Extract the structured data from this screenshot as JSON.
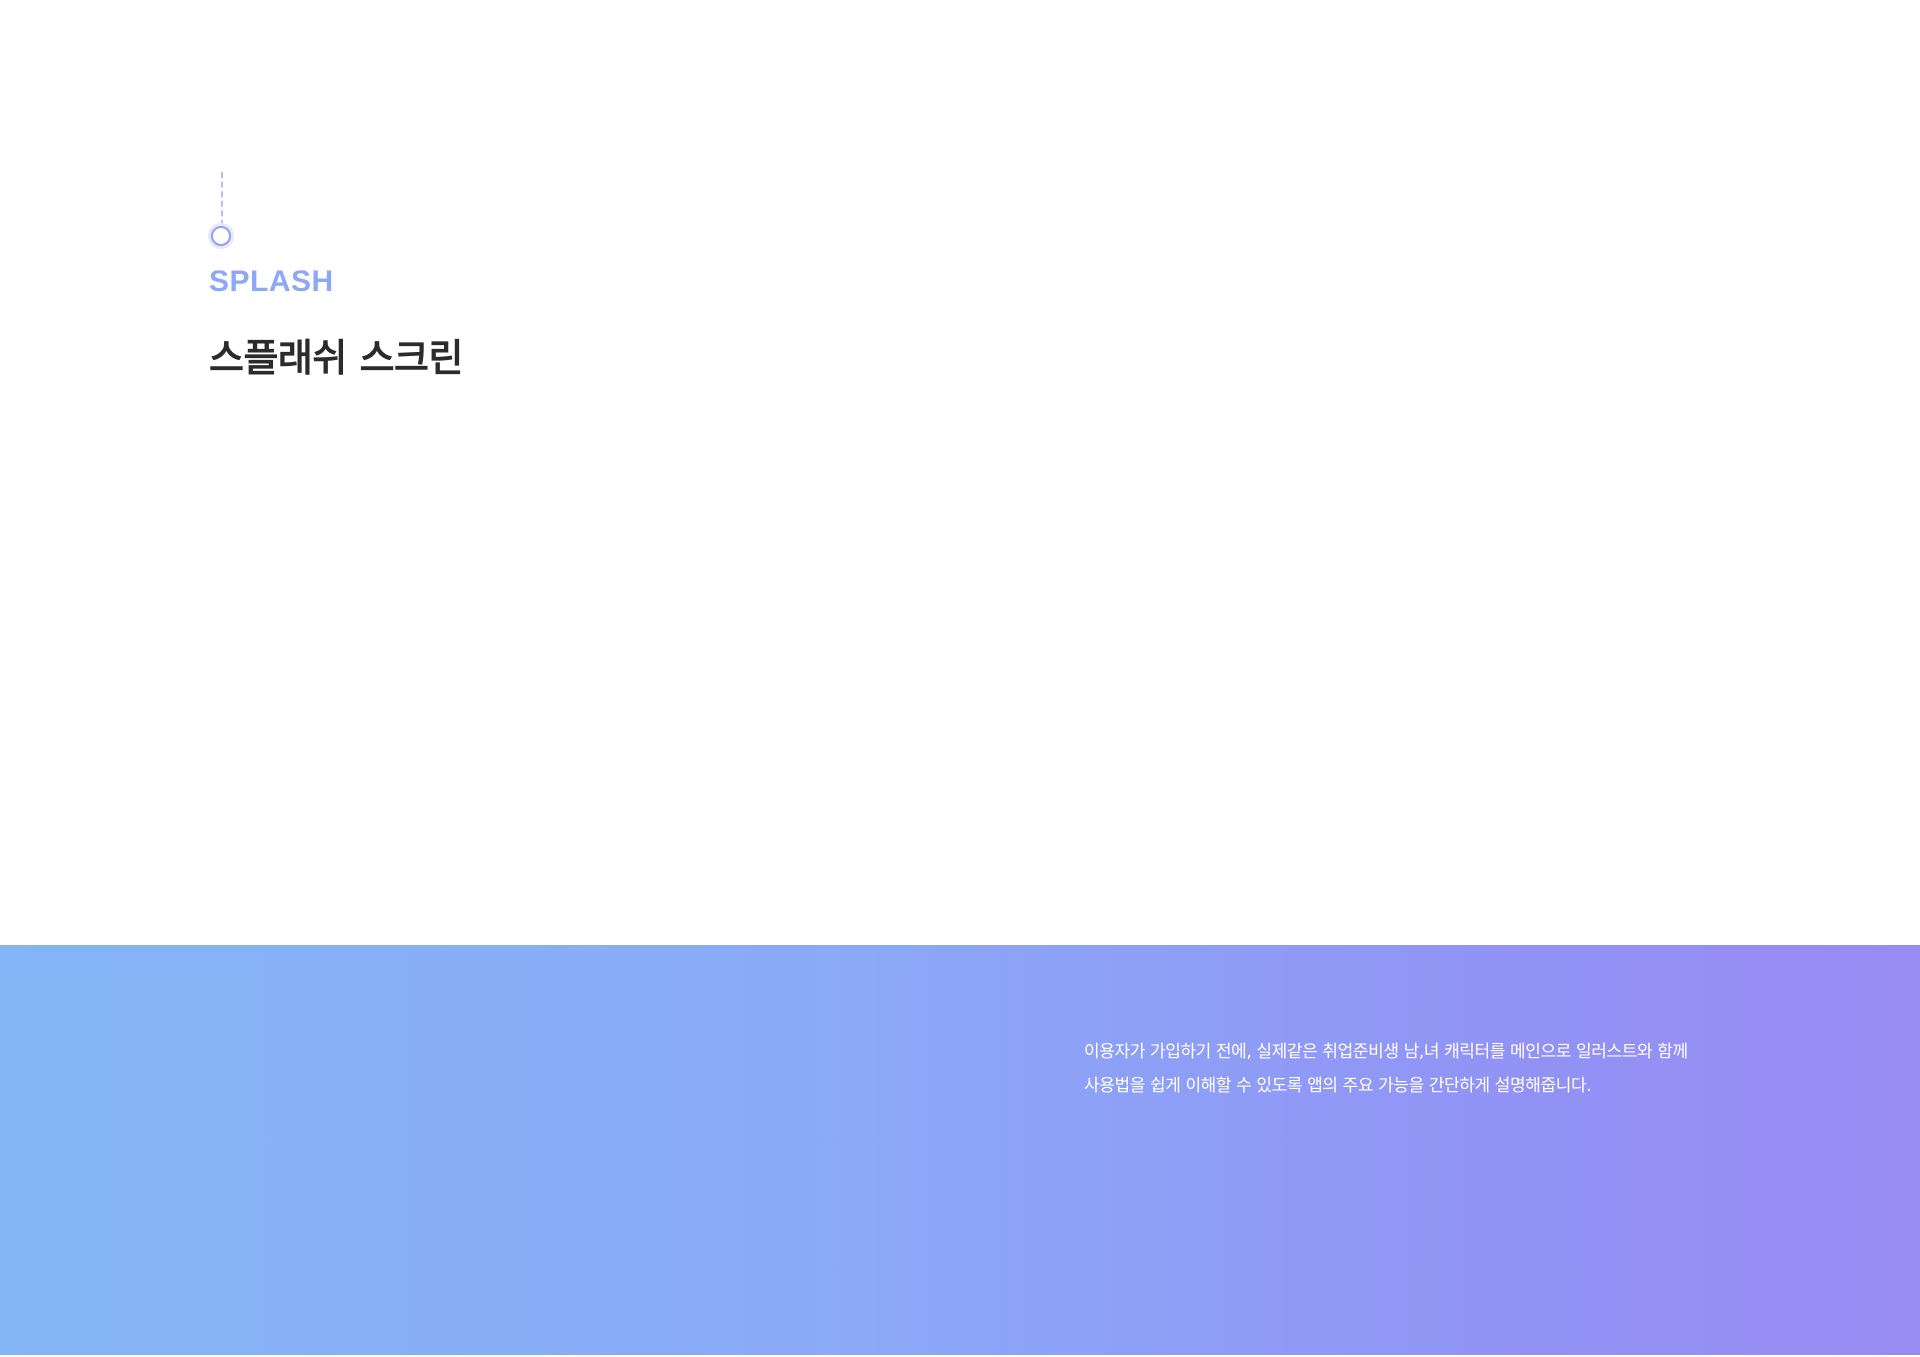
{
  "section": {
    "label": "SPLASH",
    "title": "스플래쉬 스크린"
  },
  "hero": {
    "description_lines": [
      "이용자가 가입하기 전에, 실제같은 취업준비생 남,녀 캐릭터를 메인으로 일러스트와 함께",
      "사용법을 쉽게 이해할 수 있도록 앱의 주요 가능을 간단하게 설명해줍니다."
    ]
  },
  "colors": {
    "accent": "#8ea7f6",
    "title": "#2b2b2b",
    "gradient_start": "#84b5f6",
    "gradient_end": "#988cf3"
  }
}
